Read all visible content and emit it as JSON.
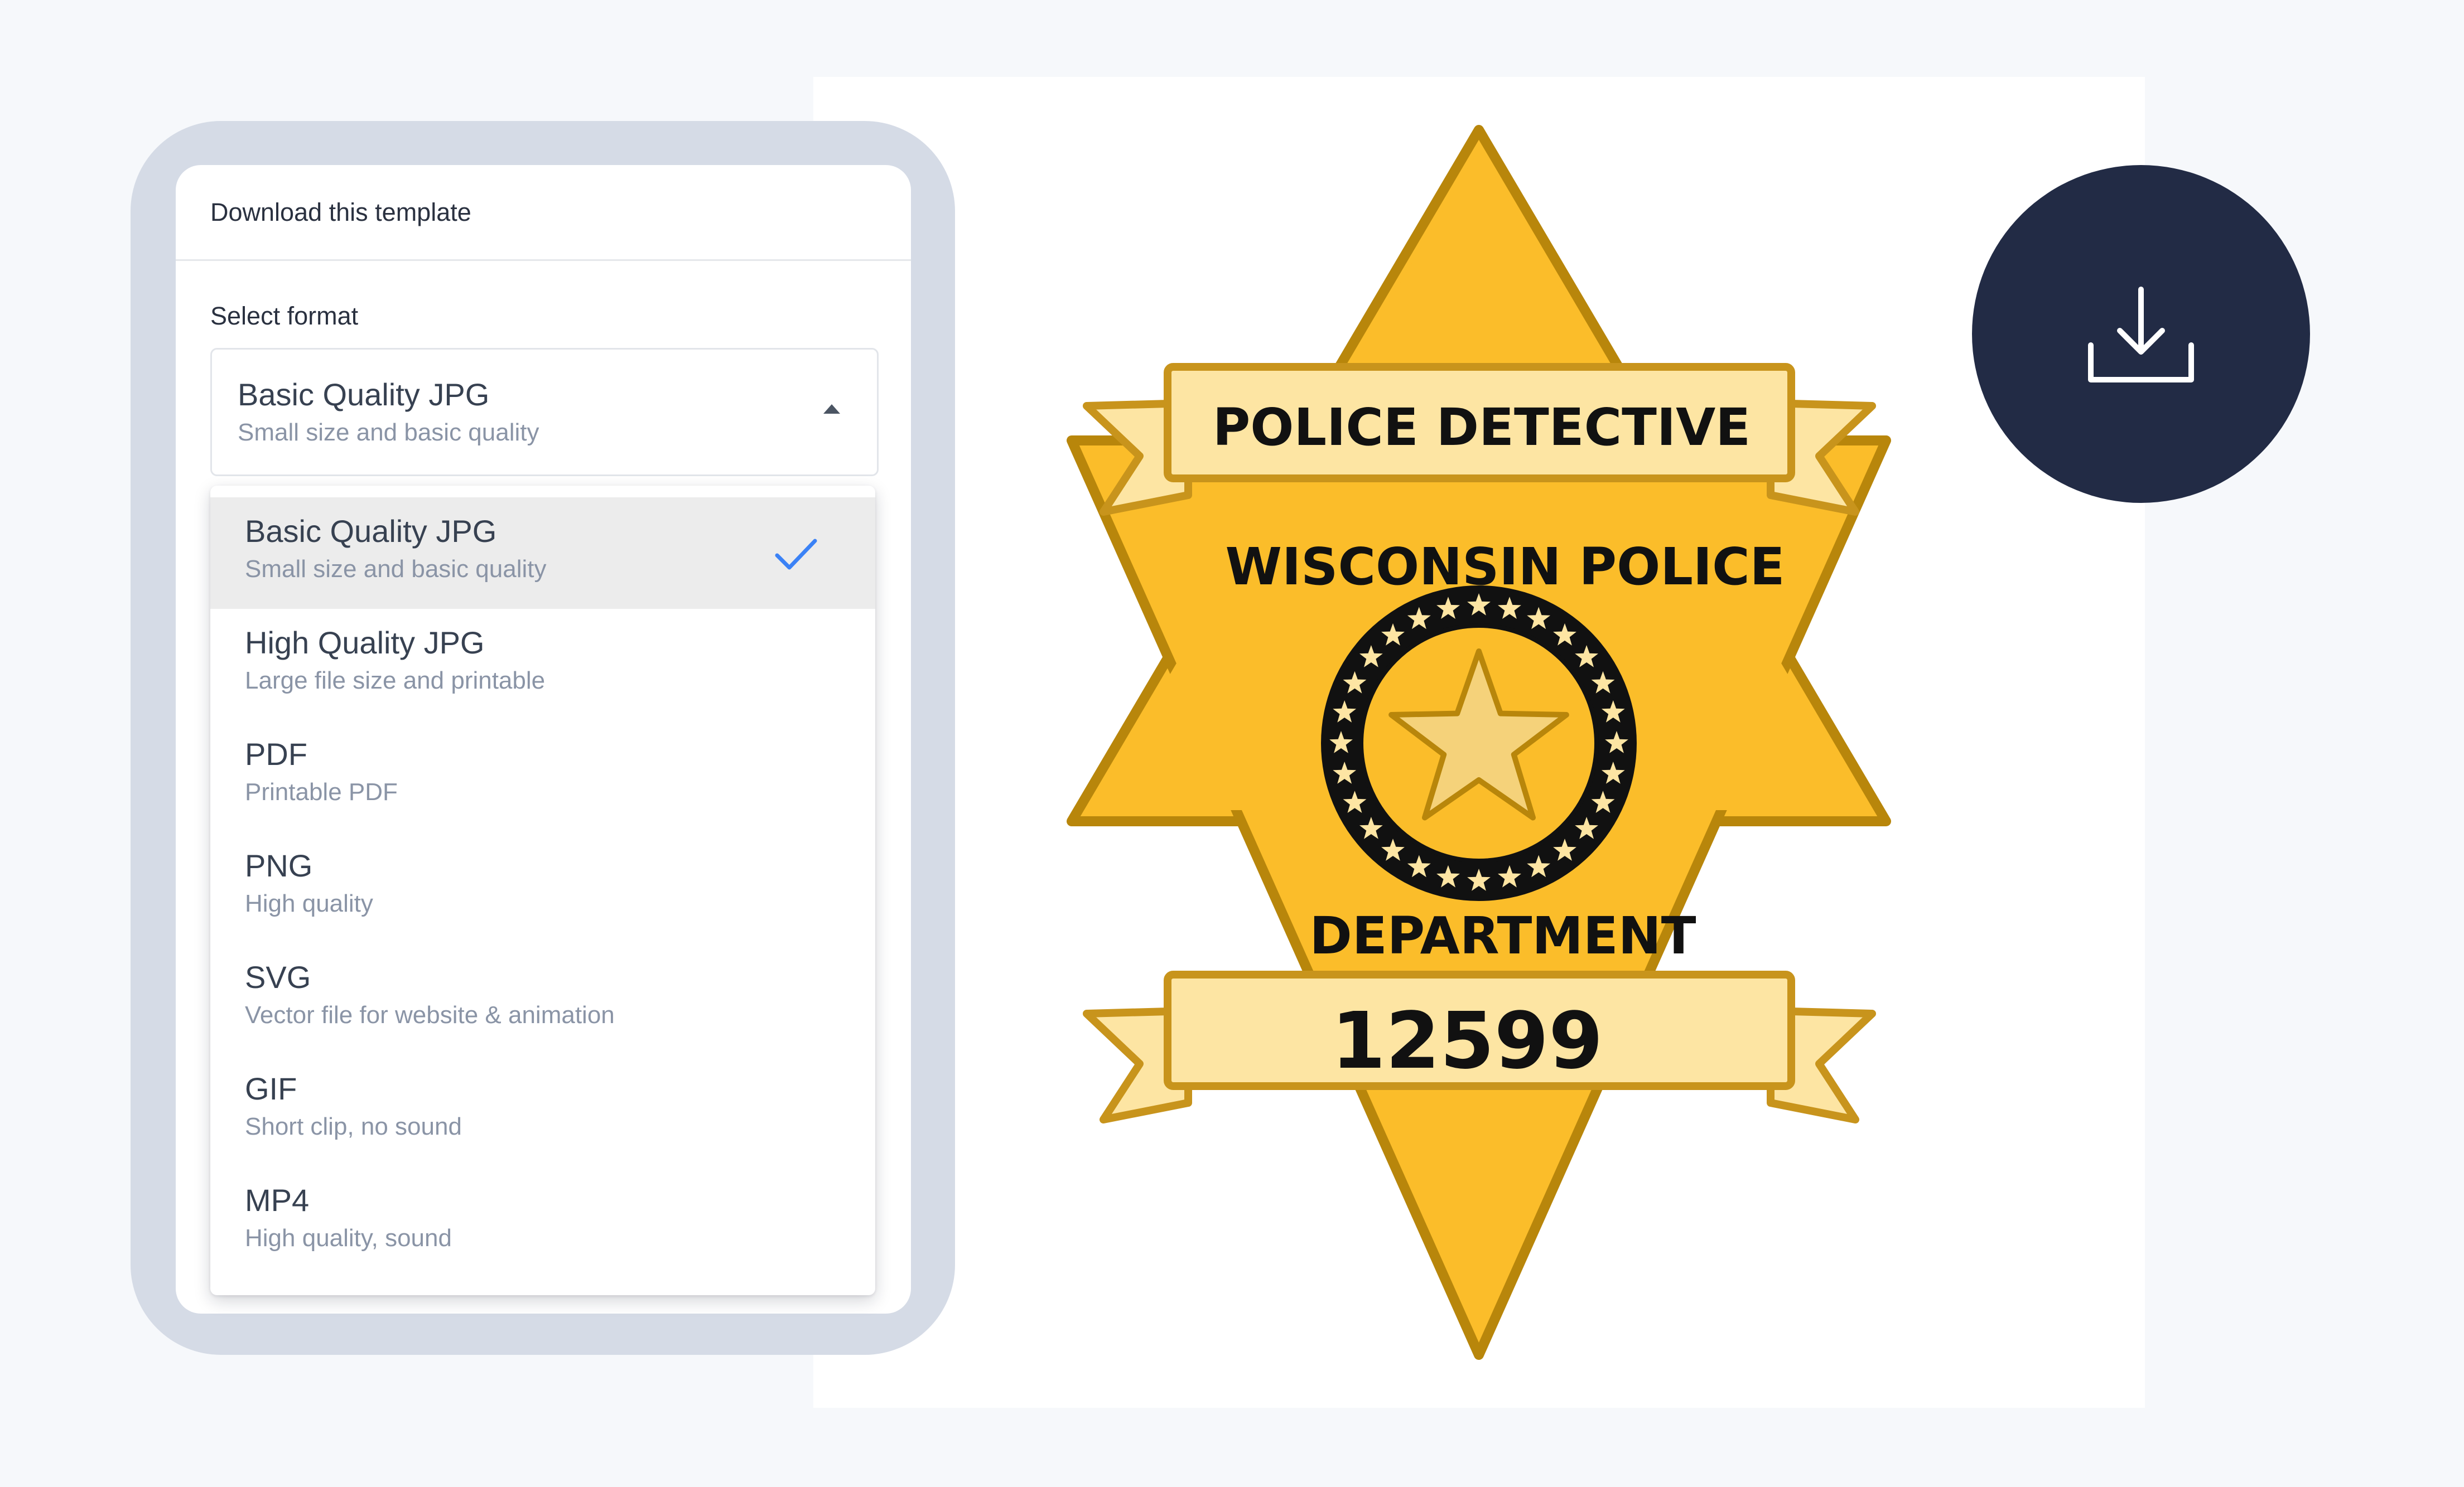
{
  "panel": {
    "header": "Download this template",
    "select_label": "Select format",
    "selected_title": "Basic Quality JPG",
    "selected_subtitle": "Small size and basic quality"
  },
  "formats": [
    {
      "title": "Basic Quality JPG",
      "subtitle": "Small size and basic quality",
      "selected": true
    },
    {
      "title": "High Quality JPG",
      "subtitle": "Large file size and printable",
      "selected": false
    },
    {
      "title": "PDF",
      "subtitle": "Printable PDF",
      "selected": false
    },
    {
      "title": "PNG",
      "subtitle": "High quality",
      "selected": false
    },
    {
      "title": "SVG",
      "subtitle": "Vector file for website & animation",
      "selected": false
    },
    {
      "title": "GIF",
      "subtitle": "Short clip, no sound",
      "selected": false
    },
    {
      "title": "MP4",
      "subtitle": "High quality, sound",
      "selected": false
    }
  ],
  "badge": {
    "top_ribbon": "POLICE DETECTIVE",
    "line1": "WISCONSIN POLICE",
    "line2": "DEPARTMENT",
    "number": "12599",
    "colors": {
      "star_fill": "#fbbd2a",
      "star_outline": "#b8860b",
      "ribbon_fill": "#fde5a3",
      "ribbon_outline": "#c8941c",
      "text": "#111111",
      "emblem_dark": "#111111",
      "emblem_stars": "#fde5a3"
    }
  },
  "download_button": {
    "icon": "download-icon",
    "color": "#222b45"
  },
  "accent": {
    "check": "#3b82f6"
  }
}
